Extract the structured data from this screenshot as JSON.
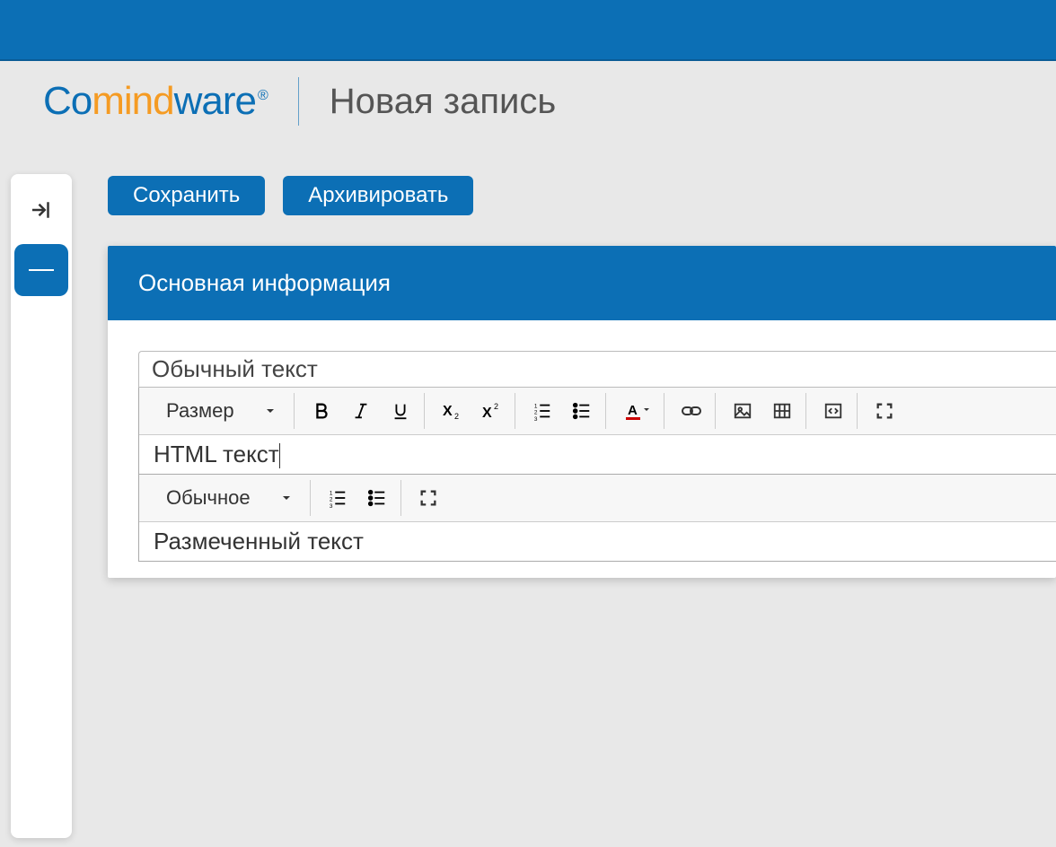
{
  "brand": {
    "part1": "Co",
    "part2": "mind",
    "part3": "ware",
    "reg": "®"
  },
  "page_title": "Новая запись",
  "actions": {
    "save": "Сохранить",
    "archive": "Архивировать"
  },
  "panel": {
    "title": "Основная информация"
  },
  "fields": {
    "plain_text_value": "Обычный текст",
    "html_text_value": "HTML текст",
    "marked_text_value": "Размеченный текст"
  },
  "toolbar1": {
    "size_label": "Размер"
  },
  "toolbar2": {
    "style_label": "Обычное"
  }
}
